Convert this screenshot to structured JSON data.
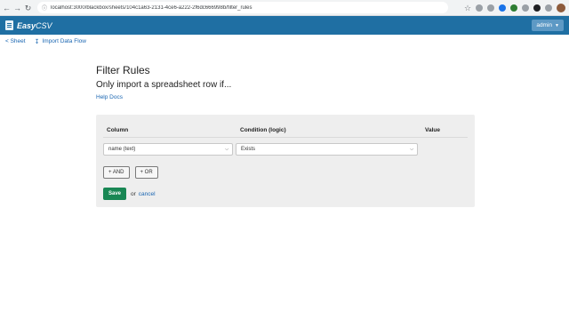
{
  "browser": {
    "url": "localhost:3000/blackbox/sheets/104c1a63-2131-4ce6-a222-2f6dc666998b/filter_rules",
    "icons": [
      "back-icon",
      "forward-icon",
      "reload-icon",
      "star-icon",
      "extension-icon",
      "puzzle-icon",
      "profile-avatar"
    ]
  },
  "app": {
    "brand_bold": "Easy",
    "brand_rest": "CSV",
    "user_menu": "admin",
    "colors": {
      "navbar": "#1f6fa3",
      "link": "#1a66b2",
      "save": "#198754"
    }
  },
  "subnav": {
    "back_label": "< Sheet",
    "import_label": "Import Data Flow"
  },
  "main": {
    "title": "Filter Rules",
    "subtitle": "Only import a spreadsheet row if...",
    "help_link": "Help Docs"
  },
  "rules": {
    "headers": {
      "column": "Column",
      "condition": "Condition (logic)",
      "value": "Value"
    },
    "row": {
      "column_value": "name (text)",
      "condition_value": "Exists"
    },
    "and_label": "+ AND",
    "or_label": "+ OR",
    "save_label": "Save",
    "or_text": "or",
    "cancel_label": "cancel"
  }
}
